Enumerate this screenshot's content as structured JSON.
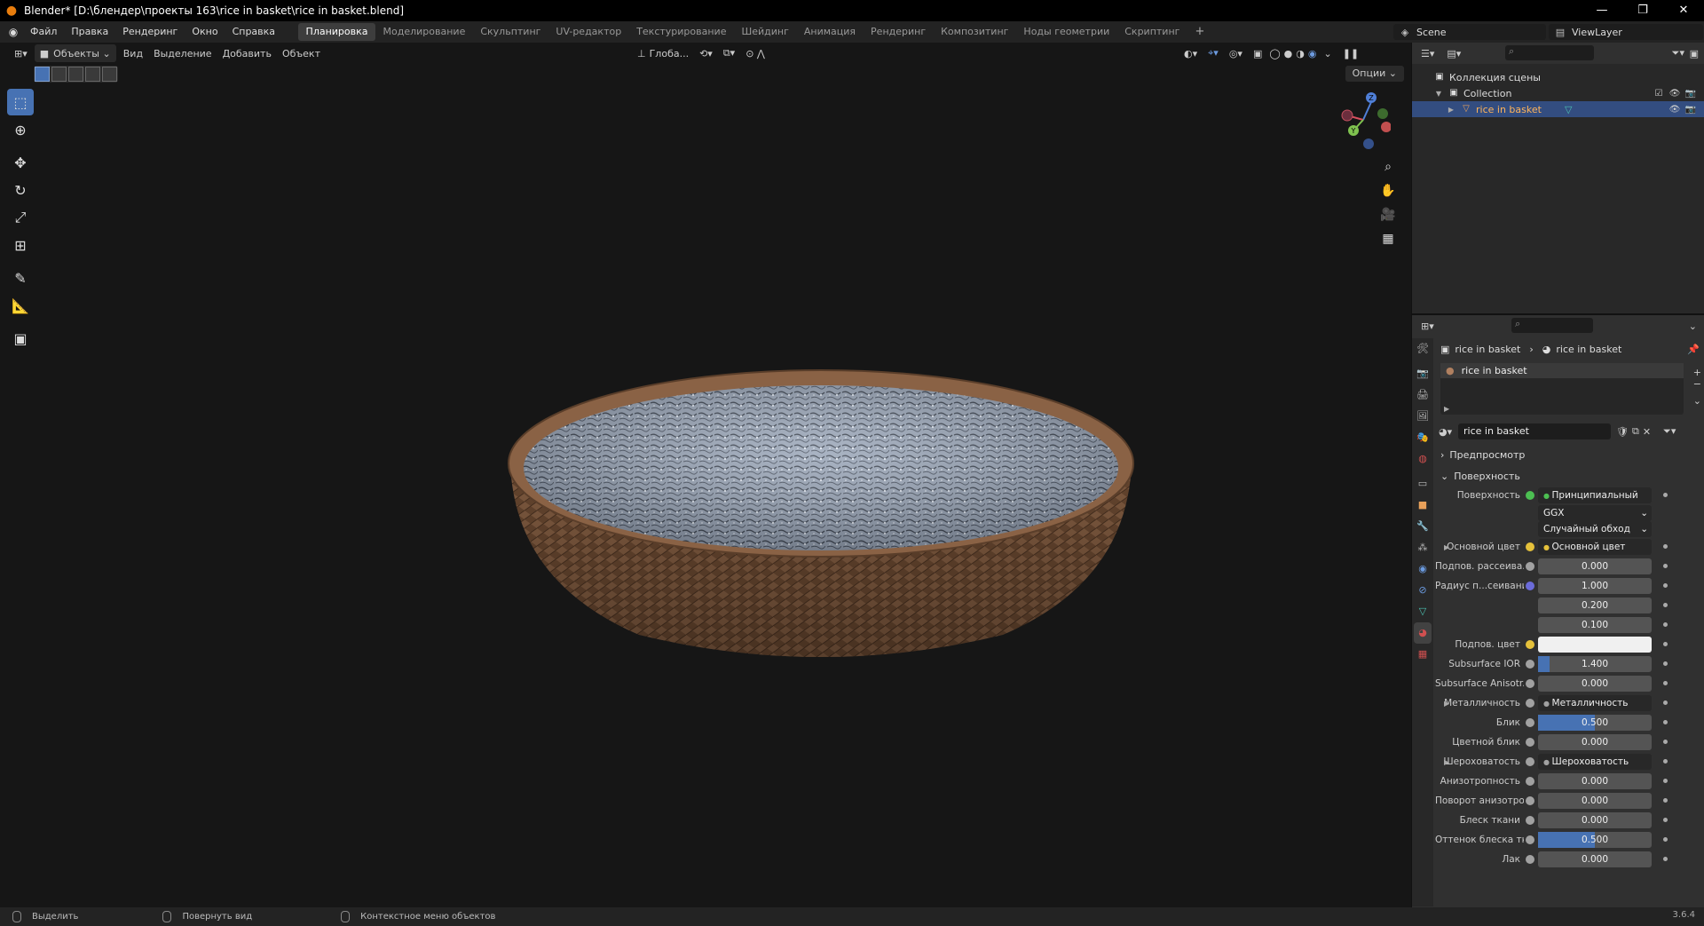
{
  "window": {
    "title": "Blender* [D:\\блендер\\проекты 163\\rice in basket\\rice in basket.blend]"
  },
  "menu": [
    "Файл",
    "Правка",
    "Рендеринг",
    "Окно",
    "Справка"
  ],
  "workspaces": [
    "Планировка",
    "Моделирование",
    "Скульптинг",
    "UV-редактор",
    "Текстурирование",
    "Шейдинг",
    "Анимация",
    "Рендеринг",
    "Композитинг",
    "Ноды геометрии",
    "Скриптинг"
  ],
  "active_workspace": "Планировка",
  "scene": "Scene",
  "view_layer": "ViewLayer",
  "viewport_header": {
    "mode": "Объекты",
    "items": [
      "Вид",
      "Выделение",
      "Добавить",
      "Объект"
    ],
    "transform": "Глоба...",
    "options": "Опции"
  },
  "outliner": {
    "root": "Коллекция сцены",
    "collection": "Collection",
    "object": "rice in basket"
  },
  "properties": {
    "breadcrumb": [
      "rice in basket",
      "rice in basket"
    ],
    "slot": "rice in basket",
    "material": "rice in basket",
    "panel_preview": "Предпросмотр",
    "panel_surface": "Поверхность",
    "rows": [
      {
        "label": "Поверхность",
        "value": "Принципиальный BSDF",
        "dot": "#4cbf52",
        "kind": "dark"
      },
      {
        "label": "",
        "value": "GGX",
        "dot": "",
        "kind": "select"
      },
      {
        "label": "",
        "value": "Случайный обход",
        "dot": "",
        "kind": "select"
      },
      {
        "label": "Основной цвет",
        "value": "Основной цвет",
        "dot": "#e5c13b",
        "kind": "dark",
        "exp": true
      },
      {
        "label": "Подпов. рассеива...",
        "value": "0.000",
        "dot": "#a1a1a1",
        "kind": "num",
        "fill": 0
      },
      {
        "label": "Радиус п...сеивания",
        "value": "1.000",
        "dot": "#6b6bd9",
        "kind": "num",
        "fill": 0
      },
      {
        "label": "",
        "value": "0.200",
        "dot": "",
        "kind": "num",
        "fill": 0
      },
      {
        "label": "",
        "value": "0.100",
        "dot": "",
        "kind": "num",
        "fill": 0
      },
      {
        "label": "Подпов. цвет",
        "value": "",
        "dot": "#e5c13b",
        "kind": "color"
      },
      {
        "label": "Subsurface IOR",
        "value": "1.400",
        "dot": "#a1a1a1",
        "kind": "num",
        "fill": 0.1
      },
      {
        "label": "Subsurface Anisotr...",
        "value": "0.000",
        "dot": "#a1a1a1",
        "kind": "num",
        "fill": 0
      },
      {
        "label": "Металличность",
        "value": "Металличность",
        "dot": "#a1a1a1",
        "kind": "dark",
        "exp": true
      },
      {
        "label": "Блик",
        "value": "0.500",
        "dot": "#a1a1a1",
        "kind": "num",
        "fill": 0.5
      },
      {
        "label": "Цветной блик",
        "value": "0.000",
        "dot": "#a1a1a1",
        "kind": "num",
        "fill": 0
      },
      {
        "label": "Шероховатость",
        "value": "Шероховатость",
        "dot": "#a1a1a1",
        "kind": "dark",
        "exp": true
      },
      {
        "label": "Анизотропность",
        "value": "0.000",
        "dot": "#a1a1a1",
        "kind": "num",
        "fill": 0
      },
      {
        "label": "Поворот анизотро...",
        "value": "0.000",
        "dot": "#a1a1a1",
        "kind": "num",
        "fill": 0
      },
      {
        "label": "Блеск ткани",
        "value": "0.000",
        "dot": "#a1a1a1",
        "kind": "num",
        "fill": 0
      },
      {
        "label": "Оттенок блеска тк...",
        "value": "0.500",
        "dot": "#a1a1a1",
        "kind": "num",
        "fill": 0.5
      },
      {
        "label": "Лак",
        "value": "0.000",
        "dot": "#a1a1a1",
        "kind": "num",
        "fill": 0
      }
    ]
  },
  "gizmo": {
    "z": "Z",
    "y": "Y"
  },
  "status": {
    "left": "Выделить",
    "middle": "Повернуть вид",
    "right": "Контекстное меню объектов",
    "version": "3.6.4"
  }
}
